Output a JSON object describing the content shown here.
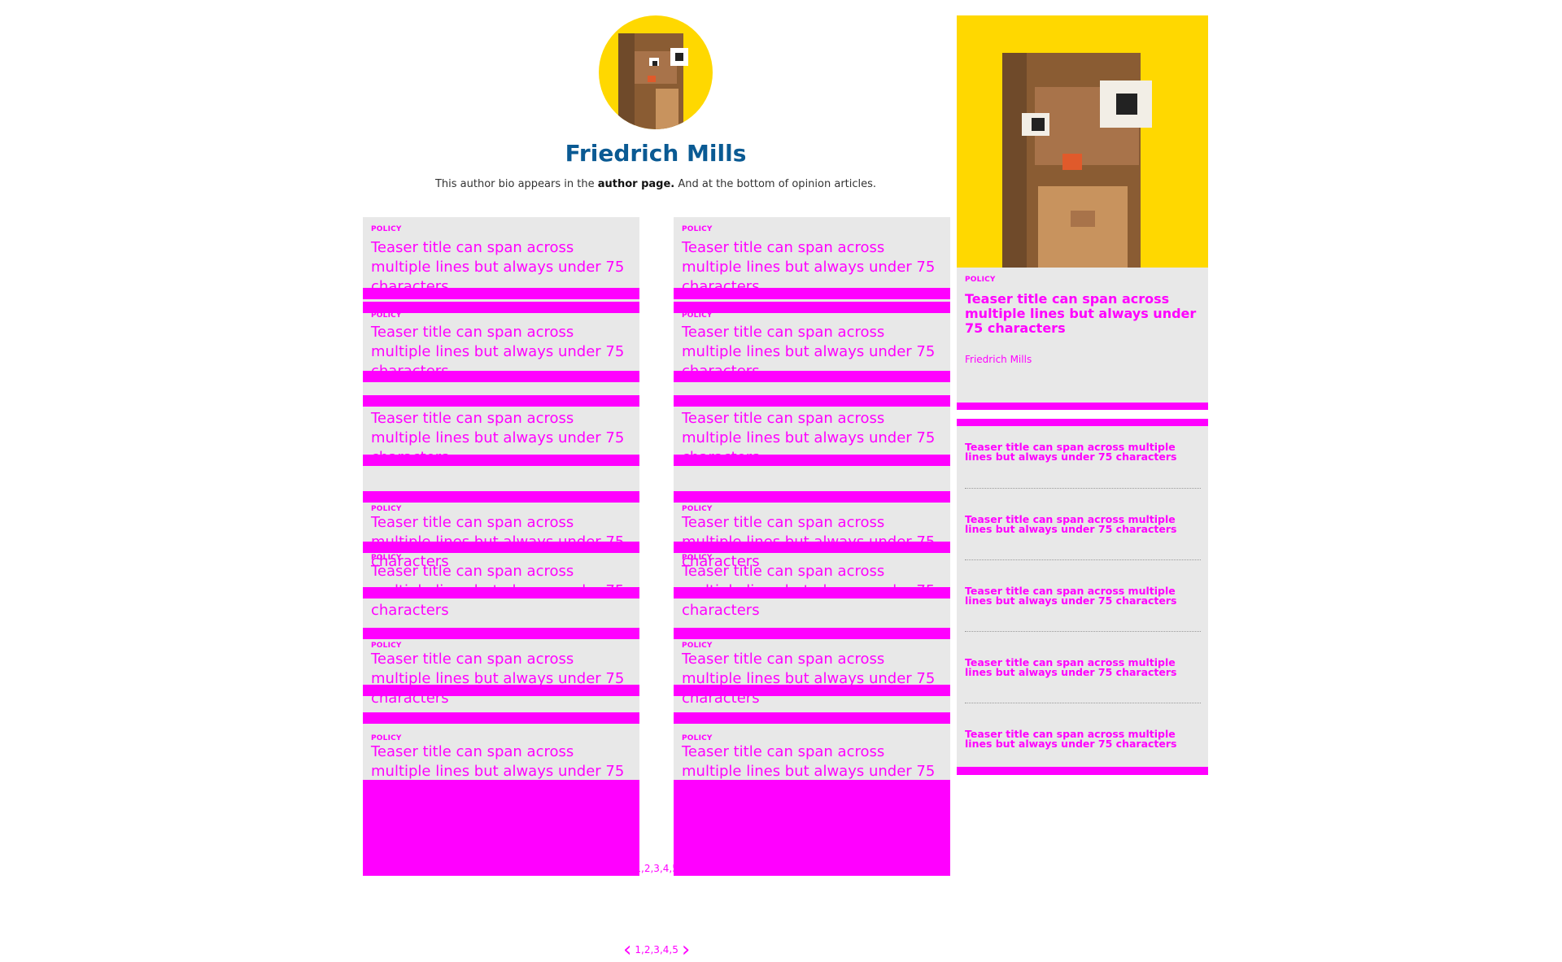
{
  "author": {
    "name": "Friedrich Mills",
    "bio_before": "This author bio appears in the ",
    "bio_strong": "author page.",
    "bio_after": " And at the bottom of opinion articles."
  },
  "teaser": {
    "kicker": "POLICY",
    "title": "Teaser title can span across multiple lines but always under 75 characters"
  },
  "sidebar": {
    "featured": {
      "kicker": "POLICY",
      "title": "Teaser title can span across multiple lines but always under 75 characters",
      "author": "Friedrich Mills"
    },
    "list_item_title": "Teaser title can span across multiple lines but always under 75 characters"
  },
  "pagination": {
    "pages": "1,2,3,4,5",
    "prev_icon": "chevron-left-icon",
    "next_icon": "chevron-right-icon"
  },
  "colors": {
    "accent": "#ff00ff",
    "author_name": "#0a5a93",
    "avatar_bg": "#ffd800",
    "panel_bg": "#e8e8e8"
  }
}
